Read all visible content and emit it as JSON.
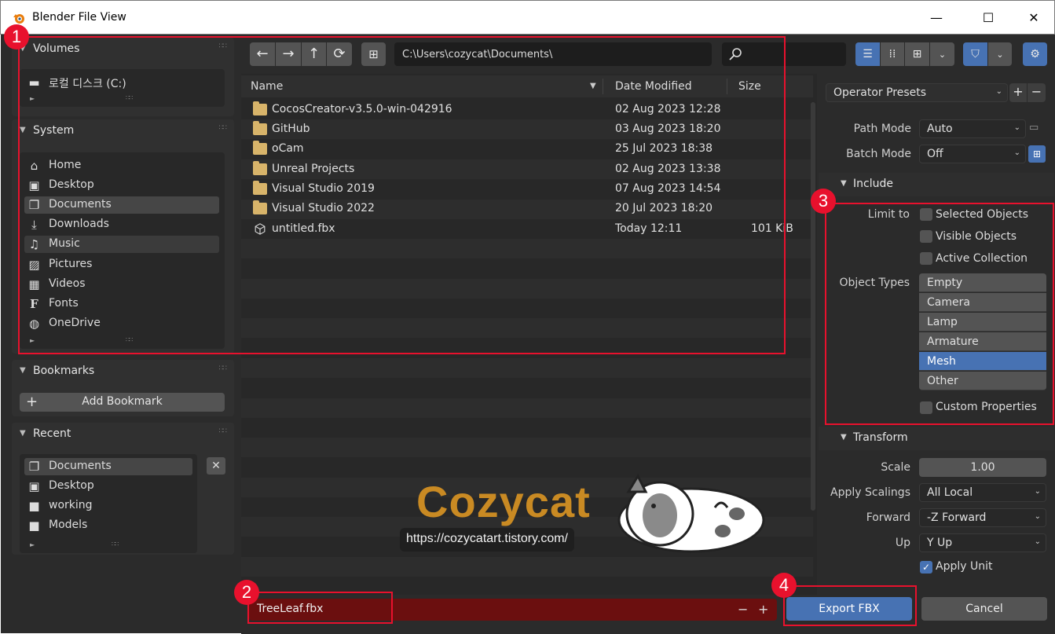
{
  "window": {
    "title": "Blender File View",
    "min": "—",
    "max": "☐",
    "close": "✕"
  },
  "sidebar": {
    "volumes": {
      "title": "Volumes",
      "items": [
        {
          "label": "로컬 디스크 (C:)",
          "icon": "drive-icon"
        }
      ]
    },
    "system": {
      "title": "System",
      "items": [
        {
          "label": "Home",
          "icon": "home-icon"
        },
        {
          "label": "Desktop",
          "icon": "desktop-icon"
        },
        {
          "label": "Documents",
          "icon": "documents-icon"
        },
        {
          "label": "Downloads",
          "icon": "download-icon"
        },
        {
          "label": "Music",
          "icon": "music-icon"
        },
        {
          "label": "Pictures",
          "icon": "picture-icon"
        },
        {
          "label": "Videos",
          "icon": "video-icon"
        },
        {
          "label": "Fonts",
          "icon": "font-icon"
        },
        {
          "label": "OneDrive",
          "icon": "globe-icon"
        }
      ]
    },
    "bookmarks": {
      "title": "Bookmarks",
      "add": "Add Bookmark"
    },
    "recent": {
      "title": "Recent",
      "items": [
        {
          "label": "Documents",
          "icon": "documents-icon"
        },
        {
          "label": "Desktop",
          "icon": "desktop-icon"
        },
        {
          "label": "working",
          "icon": "folder-icon"
        },
        {
          "label": "Models",
          "icon": "folder-icon"
        }
      ]
    }
  },
  "toolbar": {
    "path": "C:\\Users\\cozycat\\Documents\\"
  },
  "columns": {
    "name": "Name",
    "date": "Date Modified",
    "size": "Size"
  },
  "files": [
    {
      "name": "CocosCreator-v3.5.0-win-042916",
      "date": "02 Aug 2023 12:28",
      "size": "",
      "type": "folder"
    },
    {
      "name": "GitHub",
      "date": "03 Aug 2023 18:20",
      "size": "",
      "type": "folder"
    },
    {
      "name": "oCam",
      "date": "25 Jul 2023 18:38",
      "size": "",
      "type": "folder"
    },
    {
      "name": "Unreal Projects",
      "date": "02 Aug 2023 13:38",
      "size": "",
      "type": "folder"
    },
    {
      "name": "Visual Studio 2019",
      "date": "07 Aug 2023 14:54",
      "size": "",
      "type": "folder"
    },
    {
      "name": "Visual Studio 2022",
      "date": "20 Jul 2023 18:20",
      "size": "",
      "type": "folder"
    },
    {
      "name": "untitled.fbx",
      "date": "Today 12:11",
      "size": "101 KiB",
      "type": "file"
    }
  ],
  "right": {
    "presets": "Operator Presets",
    "path_mode_label": "Path Mode",
    "path_mode": "Auto",
    "batch_mode_label": "Batch Mode",
    "batch_mode": "Off",
    "include": "Include",
    "limit_to": "Limit to",
    "selected_objects": "Selected Objects",
    "visible_objects": "Visible Objects",
    "active_collection": "Active Collection",
    "object_types_label": "Object Types",
    "object_types": [
      "Empty",
      "Camera",
      "Lamp",
      "Armature",
      "Mesh",
      "Other"
    ],
    "selected_type": "Mesh",
    "custom_properties": "Custom Properties",
    "transform": "Transform",
    "scale_label": "Scale",
    "scale": "1.00",
    "apply_scalings_label": "Apply Scalings",
    "apply_scalings": "All Local",
    "forward_label": "Forward",
    "forward": "-Z Forward",
    "up_label": "Up",
    "up": "Y Up",
    "apply_unit": "Apply Unit"
  },
  "bottom": {
    "filename": "TreeLeaf.fbx",
    "export": "Export FBX",
    "cancel": "Cancel"
  },
  "annotations": [
    "1",
    "2",
    "3",
    "4"
  ],
  "watermark": {
    "title": "Cozycat",
    "url": "https://cozycatart.tistory.com/"
  },
  "colors": {
    "accent": "#4772b3",
    "annotation": "#e8112d",
    "filename_bg": "#6b0f0f",
    "folder": "#d8b46a"
  }
}
